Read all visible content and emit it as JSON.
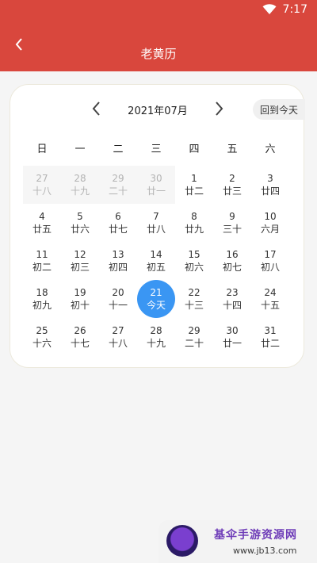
{
  "status_bar": {
    "time": "7:17",
    "wifi_icon": "wifi-icon"
  },
  "app_bar": {
    "title": "老黄历",
    "back_icon": "chevron-left-icon"
  },
  "calendar": {
    "month_label": "2021年07月",
    "prev_icon": "chevron-left-icon",
    "next_icon": "chevron-right-icon",
    "today_button": "回到今天",
    "weekdays": [
      "日",
      "一",
      "二",
      "三",
      "四",
      "五",
      "六"
    ],
    "days": [
      {
        "num": "27",
        "lunar": "十八",
        "prev": true
      },
      {
        "num": "28",
        "lunar": "十九",
        "prev": true
      },
      {
        "num": "29",
        "lunar": "二十",
        "prev": true
      },
      {
        "num": "30",
        "lunar": "廿一",
        "prev": true
      },
      {
        "num": "1",
        "lunar": "廿二"
      },
      {
        "num": "2",
        "lunar": "廿三"
      },
      {
        "num": "3",
        "lunar": "廿四"
      },
      {
        "num": "4",
        "lunar": "廿五"
      },
      {
        "num": "5",
        "lunar": "廿六"
      },
      {
        "num": "6",
        "lunar": "廿七"
      },
      {
        "num": "7",
        "lunar": "廿八"
      },
      {
        "num": "8",
        "lunar": "廿九"
      },
      {
        "num": "9",
        "lunar": "三十"
      },
      {
        "num": "10",
        "lunar": "六月"
      },
      {
        "num": "11",
        "lunar": "初二"
      },
      {
        "num": "12",
        "lunar": "初三"
      },
      {
        "num": "13",
        "lunar": "初四"
      },
      {
        "num": "14",
        "lunar": "初五"
      },
      {
        "num": "15",
        "lunar": "初六"
      },
      {
        "num": "16",
        "lunar": "初七"
      },
      {
        "num": "17",
        "lunar": "初八"
      },
      {
        "num": "18",
        "lunar": "初九"
      },
      {
        "num": "19",
        "lunar": "初十"
      },
      {
        "num": "20",
        "lunar": "十一"
      },
      {
        "num": "21",
        "lunar": "今天",
        "today": true
      },
      {
        "num": "22",
        "lunar": "十三"
      },
      {
        "num": "23",
        "lunar": "十四"
      },
      {
        "num": "24",
        "lunar": "十五"
      },
      {
        "num": "25",
        "lunar": "十六"
      },
      {
        "num": "26",
        "lunar": "十七"
      },
      {
        "num": "27",
        "lunar": "十八"
      },
      {
        "num": "28",
        "lunar": "十九"
      },
      {
        "num": "29",
        "lunar": "二十"
      },
      {
        "num": "30",
        "lunar": "廿一"
      },
      {
        "num": "31",
        "lunar": "廿二"
      }
    ]
  },
  "watermark": {
    "title": "基伞手游资源网",
    "url": "www.jb13.com"
  },
  "colors": {
    "app_bar": "#d9473d",
    "today_highlight": "#3a96f3",
    "page_bg": "#f5f5f5"
  }
}
